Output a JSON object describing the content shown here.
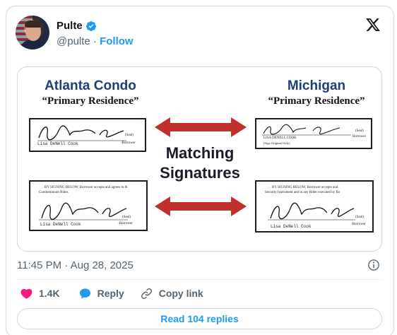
{
  "author": {
    "display_name": "Pulte",
    "handle": "@pulte",
    "separator": "·",
    "follow_label": "Follow"
  },
  "media": {
    "left_title": "Atlanta Condo",
    "left_subtitle": "“Primary Residence”",
    "right_title": "Michigan",
    "right_subtitle": "“Primary Residence”",
    "center_line1": "Matching",
    "center_line2": "Signatures",
    "sig_tl": {
      "name": "Lisa DeNell Cook",
      "seal": "(Seal)",
      "role": "-Borrower"
    },
    "sig_bl": {
      "text1": "BY SIGNING BELOW, Borrower accepts and agrees to th",
      "text2": "Condominium Rider.",
      "name": "Lisa DeNell Cook",
      "seal": "(Seal)",
      "role": "-Borrower"
    },
    "sig_tr": {
      "name": "LISA DENELL COOK",
      "note": "(Sign Original Only)",
      "seal": "(Seal)",
      "role": "Borrower"
    },
    "sig_br": {
      "text1": "BY SIGNING BELOW, Borrower accepts and",
      "text2": "Security Instrument and in any Rider executed by Bo",
      "name": "Lisa DeNell Cook",
      "seal": "(Seal)",
      "role": "-Borrower"
    }
  },
  "timestamp": "11:45 PM · Aug 28, 2025",
  "actions": {
    "likes": "1.4K",
    "reply": "Reply",
    "copy_link": "Copy link"
  },
  "read_replies": "Read 104 replies",
  "colors": {
    "accent": "#1d9bf0",
    "like": "#f91880",
    "arrow": "#c0312b",
    "title_blue": "#1e3f76"
  },
  "icons": [
    "verified-badge-icon",
    "x-logo-icon",
    "info-icon",
    "heart-icon",
    "reply-icon",
    "link-icon"
  ]
}
